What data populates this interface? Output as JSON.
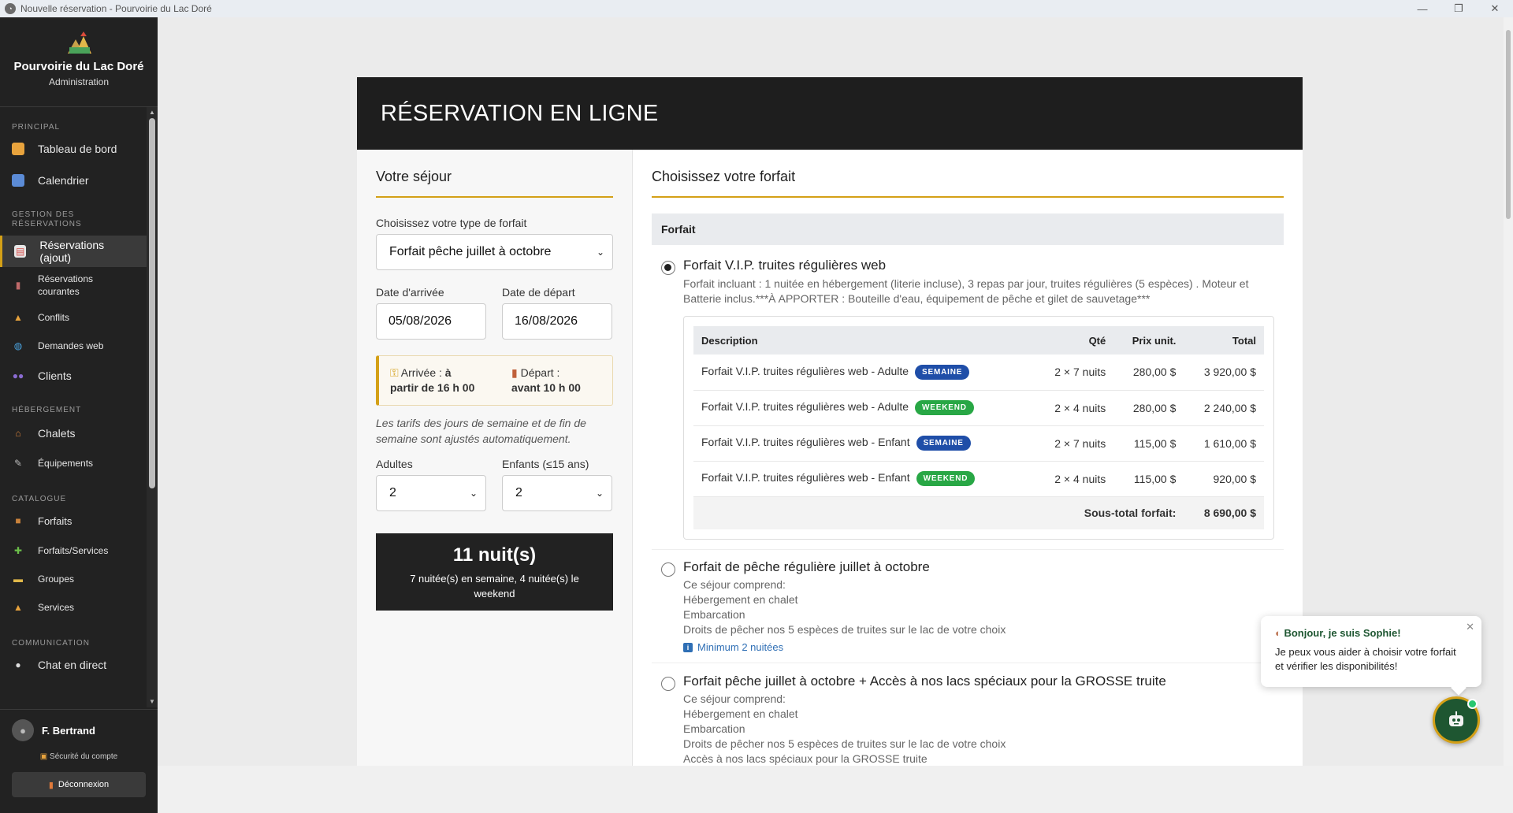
{
  "window": {
    "title": "Nouvelle réservation - Pourvoirie du Lac Doré"
  },
  "sidebar": {
    "brand": {
      "title": "Pourvoirie du Lac Doré",
      "subtitle": "Administration"
    },
    "sections": {
      "principal": "PRINCIPAL",
      "gestion": "GESTION DES RÉSERVATIONS",
      "hebergement": "HÉBERGEMENT",
      "catalogue": "CATALOGUE",
      "communication": "COMMUNICATION"
    },
    "items": {
      "tableau": "Tableau de bord",
      "calendrier": "Calendrier",
      "reservations_ajout": "Réservations (ajout)",
      "reservations_courantes": "Réservations courantes",
      "conflits": "Conflits",
      "demandes_web": "Demandes web",
      "clients": "Clients",
      "chalets": "Chalets",
      "equipements": "Équipements",
      "forfaits": "Forfaits",
      "forfaits_services": "Forfaits/Services",
      "groupes": "Groupes",
      "services": "Services",
      "chat": "Chat en direct"
    },
    "user": {
      "name": "F. Bertrand",
      "security": "Sécurité du compte",
      "logout": "Déconnexion"
    }
  },
  "header": {
    "title": "RÉSERVATION EN LIGNE"
  },
  "stay": {
    "title": "Votre séjour",
    "type_label": "Choisissez votre type de forfait",
    "type_value": "Forfait pêche juillet à octobre",
    "arrival_label": "Date d'arrivée",
    "arrival_value": "05/08/2026",
    "departure_label": "Date de départ",
    "departure_value": "16/08/2026",
    "arrival_info_label": "Arrivée :",
    "arrival_info_a": "à",
    "arrival_info_b": "partir de 16 h 00",
    "departure_info_label": "Départ :",
    "departure_info_value": "avant 10 h 00",
    "note": "Les tarifs des jours de semaine et de fin de semaine sont ajustés automatiquement.",
    "adults_label": "Adultes",
    "adults_value": "2",
    "children_label": "Enfants (≤15 ans)",
    "children_value": "2",
    "nights_big": "11 nuit(s)",
    "nights_small": "7 nuitée(s) en semaine, 4 nuitée(s) le weekend"
  },
  "packages": {
    "title": "Choisissez votre forfait",
    "header": "Forfait",
    "p1": {
      "title": "Forfait V.I.P. truites régulières web",
      "desc": "Forfait incluant : 1 nuitée en hébergement (literie incluse), 3 repas par jour, truites régulières (5 espèces) . Moteur et Batterie inclus.***À APPORTER : Bouteille d'eau, équipement de pêche et gilet de sauvetage***",
      "table": {
        "headers": {
          "desc": "Description",
          "qty": "Qté",
          "unit": "Prix unit.",
          "total": "Total"
        },
        "rows": [
          {
            "desc": "Forfait V.I.P. truites régulières web - Adulte",
            "badge": "SEMAINE",
            "qty": "2 × 7 nuits",
            "unit": "280,00 $",
            "total": "3 920,00 $"
          },
          {
            "desc": "Forfait V.I.P. truites régulières web - Adulte",
            "badge": "WEEKEND",
            "qty": "2 × 4 nuits",
            "unit": "280,00 $",
            "total": "2 240,00 $"
          },
          {
            "desc": "Forfait V.I.P. truites régulières web - Enfant",
            "badge": "SEMAINE",
            "qty": "2 × 7 nuits",
            "unit": "115,00 $",
            "total": "1 610,00 $"
          },
          {
            "desc": "Forfait V.I.P. truites régulières web - Enfant",
            "badge": "WEEKEND",
            "qty": "2 × 4 nuits",
            "unit": "115,00 $",
            "total": "920,00 $"
          }
        ],
        "subtotal_label": "Sous-total forfait:",
        "subtotal_value": "8 690,00 $"
      }
    },
    "p2": {
      "title": "Forfait de pêche régulière juillet à octobre",
      "lines": [
        "Ce séjour comprend:",
        "Hébergement en chalet",
        "Embarcation",
        "Droits de pêcher nos 5 espèces de truites sur le lac de votre choix"
      ],
      "minimum": "Minimum 2 nuitées"
    },
    "p3": {
      "title": "Forfait pêche juillet à octobre + Accès à nos lacs spéciaux pour la GROSSE truite",
      "lines": [
        "Ce séjour comprend:",
        "Hébergement en chalet",
        "Embarcation",
        "Droits de pêcher nos 5 espèces de truites sur le lac de votre choix",
        "Accès à nos lacs spéciaux pour la GROSSE truite"
      ]
    }
  },
  "chat": {
    "hello": "Bonjour, je suis Sophie!",
    "message": "Je peux vous aider à choisir votre forfait et vérifier les disponibilités!"
  },
  "colors": {
    "accent": "#d4a017",
    "dark": "#222222",
    "badge_week": "#1f4ea8",
    "badge_weekend": "#28a745",
    "chat": "#1e5631"
  }
}
